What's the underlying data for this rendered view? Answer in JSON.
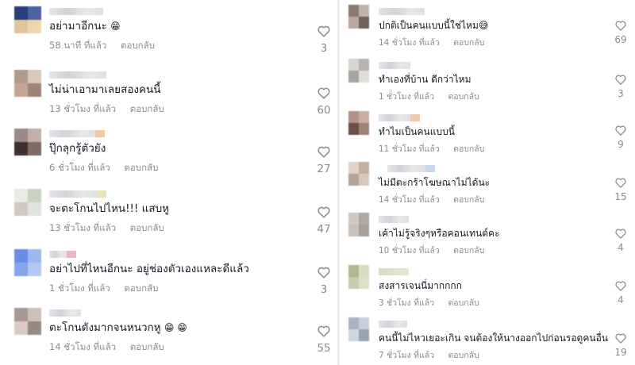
{
  "reply_label": "ตอบกลับ",
  "left_comments": [
    {
      "text": "อย่ามาอีกนะ",
      "emoji": "😁",
      "time": "58 นาที ที่แล้ว",
      "likes": "3"
    },
    {
      "text": "ไม่น่าเอามาเลยสองคนนี้",
      "emoji": "",
      "time": "13 ชั่วโมง ที่แล้ว",
      "likes": "60"
    },
    {
      "text": "ปุ๊กลุกรู้ตัวยัง",
      "emoji": "",
      "time": "6 ชั่วโมง ที่แล้ว",
      "likes": "27"
    },
    {
      "text": "จะตะโกนไปไหน!!! แสบหู",
      "emoji": "",
      "time": "13 ชั่วโมง ที่แล้ว",
      "likes": "47"
    },
    {
      "text": "อย่าไปที่ไหนอีกนะ อยู่ช่องตัวเองแหละดีแล้ว",
      "emoji": "",
      "time": "1 ชั่วโมง ที่แล้ว",
      "likes": "3"
    },
    {
      "text": "ตะโกนดังมากจนหนวกหู",
      "emoji": "😁 😁",
      "time": "14 ชั่วโมง ที่แล้ว",
      "likes": "55"
    }
  ],
  "right_comments": [
    {
      "text": "ปกติเป็นคนแบบนี้ใช่ไหม",
      "emoji": "😅",
      "time": "14 ชั่วโมง ที่แล้ว",
      "likes": "69"
    },
    {
      "text": "ทำเองที่บ้าน ดีกว่าไหม",
      "emoji": "",
      "time": "1 ชั่วโมง ที่แล้ว",
      "likes": "3"
    },
    {
      "text": "ทำไมเป็นคนแบบนี้",
      "emoji": "",
      "time": "11 ชั่วโมง ที่แล้ว",
      "likes": "9"
    },
    {
      "text": "ไม่มีตะกร้าโฆษณาไม่ได้นะ",
      "emoji": "",
      "time": "14 ชั่วโมง ที่แล้ว",
      "likes": "15"
    },
    {
      "text": "เค้าไม่รู้จริงๆหรือคอนเทนต์คะ",
      "emoji": "",
      "time": "10 ชั่วโมง ที่แล้ว",
      "likes": "4"
    },
    {
      "text": "สงสารเจนนี่มากกกก",
      "emoji": "",
      "time": "3 ชั่วโมง ที่แล้ว",
      "likes": "4"
    },
    {
      "text": "คนนี้ไม่ไหวเยอะเกิน จนต้องให้นางออกไปก่อนรอดูคนอื่น",
      "emoji": "",
      "time": "7 ชั่วโมง ที่แล้ว",
      "likes": "19"
    }
  ],
  "colors": {
    "text": "#161823",
    "meta": "#8a8b91",
    "heart_outline": "#8a8b91"
  }
}
